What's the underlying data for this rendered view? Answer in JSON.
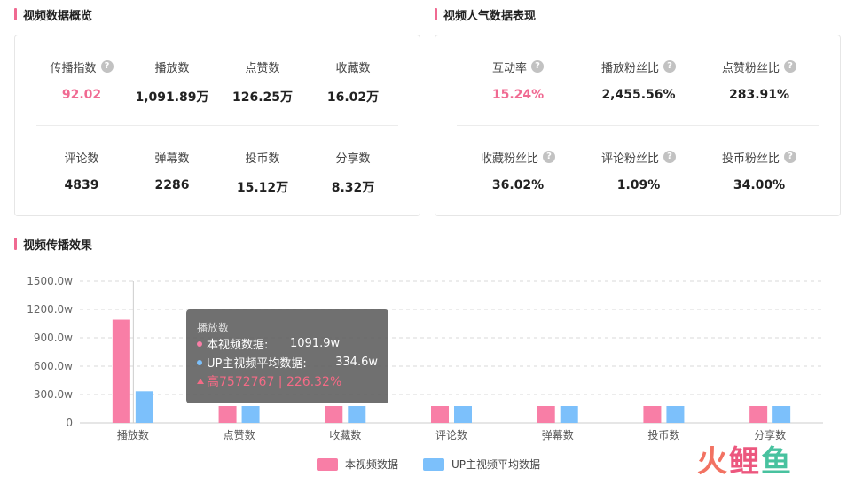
{
  "overview": {
    "title": "视频数据概览",
    "row1": [
      {
        "label": "传播指数",
        "value": "92.02",
        "highlight": true,
        "help": true
      },
      {
        "label": "播放数",
        "value": "1,091.89万"
      },
      {
        "label": "点赞数",
        "value": "126.25万"
      },
      {
        "label": "收藏数",
        "value": "16.02万"
      }
    ],
    "row2": [
      {
        "label": "评论数",
        "value": "4839"
      },
      {
        "label": "弹幕数",
        "value": "2286"
      },
      {
        "label": "投币数",
        "value": "15.12万"
      },
      {
        "label": "分享数",
        "value": "8.32万"
      }
    ]
  },
  "popularity": {
    "title": "视频人气数据表现",
    "row1": [
      {
        "label": "互动率",
        "value": "15.24%",
        "highlight": true,
        "help": true
      },
      {
        "label": "播放粉丝比",
        "value": "2,455.56%",
        "help": true
      },
      {
        "label": "点赞粉丝比",
        "value": "283.91%",
        "help": true
      }
    ],
    "row2": [
      {
        "label": "收藏粉丝比",
        "value": "36.02%",
        "help": true
      },
      {
        "label": "评论粉丝比",
        "value": "1.09%",
        "help": true
      },
      {
        "label": "投币粉丝比",
        "value": "34.00%",
        "help": true
      }
    ]
  },
  "effect": {
    "title": "视频传播效果"
  },
  "tooltip": {
    "title": "播放数",
    "row1_name": "本视频数据:",
    "row1_value": "1091.9w",
    "row2_name": "UP主视频平均数据:",
    "row2_value": "334.6w",
    "diff": "高7572767 | 226.32%"
  },
  "watermark": {
    "text_a": "火",
    "text_b": "鲤",
    "text_c": "鱼"
  },
  "colors": {
    "pink": "#f87ea6",
    "blue": "#7cc0fb",
    "accent": "#f06a92"
  },
  "chart_data": {
    "type": "bar",
    "categories": [
      "播放数",
      "点赞数",
      "收藏数",
      "评论数",
      "弹幕数",
      "投币数",
      "分享数"
    ],
    "series": [
      {
        "name": "本视频数据",
        "values": [
          1091.9,
          126.25,
          16.02,
          0.48,
          0.23,
          15.12,
          8.32
        ]
      },
      {
        "name": "UP主视频平均数据",
        "values": [
          334.6,
          30,
          5,
          0.2,
          0.1,
          5,
          2
        ]
      }
    ],
    "yticks": [
      "0",
      "300.0w",
      "600.0w",
      "900.0w",
      "1200.0w",
      "1500.0w"
    ],
    "ylim": [
      0,
      1500
    ],
    "grid": true,
    "legend": "bottom-center",
    "xlabel": "",
    "ylabel": ""
  }
}
